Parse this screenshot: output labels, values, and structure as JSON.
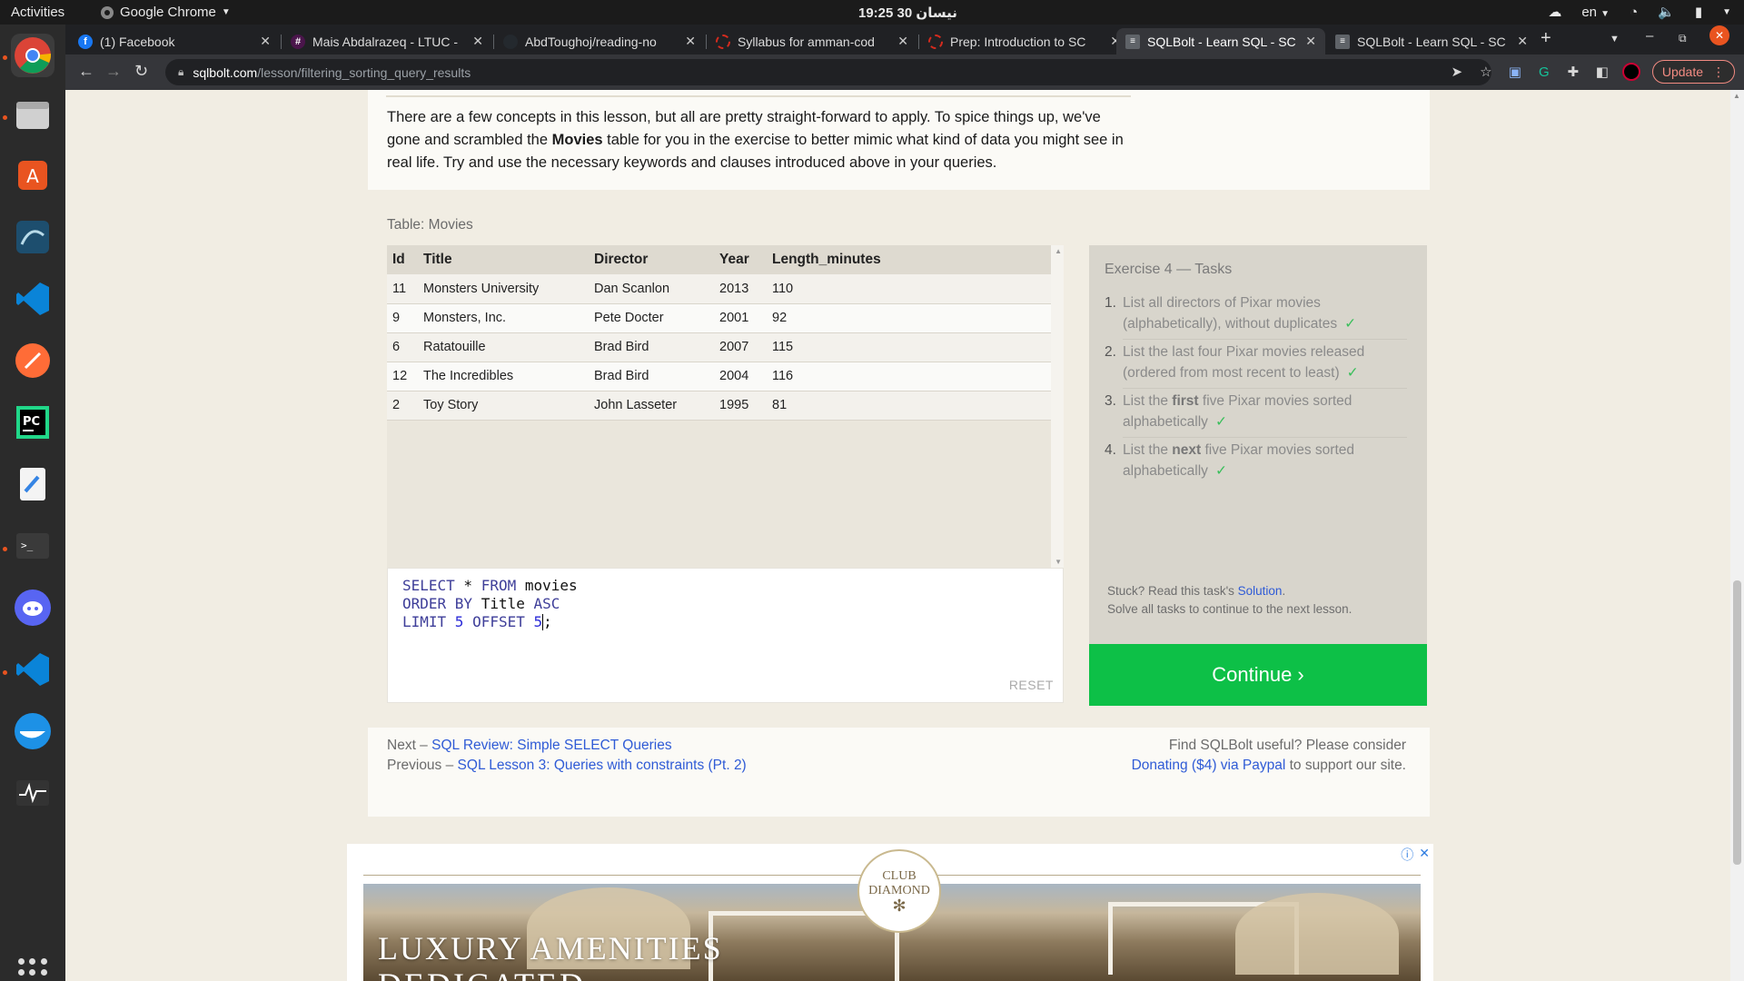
{
  "topbar": {
    "activities": "Activities",
    "app_name": "Google Chrome",
    "clock": "19:25  30 نيسان",
    "lang": "en"
  },
  "tabs": [
    {
      "title": "(1) Facebook",
      "favicon_color": "#1877f2",
      "favicon_glyph": "f"
    },
    {
      "title": "Mais Abdalrazeq - LTUC -",
      "favicon_color": "#4a154b",
      "favicon_glyph": "#"
    },
    {
      "title": "AbdToughoj/reading-no",
      "favicon_color": "#24292e",
      "favicon_glyph": "●"
    },
    {
      "title": "Syllabus for amman-cod",
      "favicon_color": "#d52b1e",
      "favicon_glyph": "○"
    },
    {
      "title": "Prep: Introduction to SC",
      "favicon_color": "#d52b1e",
      "favicon_glyph": "○"
    },
    {
      "title": "SQLBolt - Learn SQL - SC",
      "favicon_color": "#9aa0a6",
      "favicon_glyph": "≡"
    },
    {
      "title": "SQLBolt - Learn SQL - SC",
      "favicon_color": "#9aa0a6",
      "favicon_glyph": "≡"
    }
  ],
  "address": {
    "host": "sqlbolt.com",
    "path": "/lesson/filtering_sorting_query_results"
  },
  "update_label": "Update",
  "intro": {
    "part1": "There are a few concepts in this lesson, but all are pretty straight-forward to apply. To spice things up, we've gone and scrambled the ",
    "bold": "Movies",
    "part2": " table for you in the exercise to better mimic what kind of data you might see in real life. Try and use the necessary keywords and clauses introduced above in your queries."
  },
  "table": {
    "caption": "Table: Movies",
    "columns": [
      "Id",
      "Title",
      "Director",
      "Year",
      "Length_minutes"
    ],
    "rows": [
      [
        "11",
        "Monsters University",
        "Dan Scanlon",
        "2013",
        "110"
      ],
      [
        "9",
        "Monsters, Inc.",
        "Pete Docter",
        "2001",
        "92"
      ],
      [
        "6",
        "Ratatouille",
        "Brad Bird",
        "2007",
        "115"
      ],
      [
        "12",
        "The Incredibles",
        "Brad Bird",
        "2004",
        "116"
      ],
      [
        "2",
        "Toy Story",
        "John Lasseter",
        "1995",
        "81"
      ]
    ]
  },
  "editor": {
    "line1": {
      "kw1": "SELECT",
      "mid": " * ",
      "kw2": "FROM",
      "rest": " movies"
    },
    "line2": {
      "kw1": "ORDER BY",
      "mid": " Title ",
      "kw2": "ASC"
    },
    "line3": {
      "kw1": "LIMIT",
      "num1": " 5 ",
      "kw2": "OFFSET",
      "num2": " 5",
      "tail": ";"
    },
    "reset_label": "RESET"
  },
  "tasks": {
    "heading": "Exercise 4 — Tasks",
    "items": [
      {
        "n": "1.",
        "pre": "List all directors of Pixar movies (alphabetically), without duplicates",
        "bold": "",
        "post": "",
        "done": "✓"
      },
      {
        "n": "2.",
        "pre": "List the last four Pixar movies released (ordered from most recent to least)",
        "bold": "",
        "post": "",
        "done": "✓"
      },
      {
        "n": "3.",
        "pre": "List the ",
        "bold": "first",
        "post": " five Pixar movies sorted alphabetically",
        "done": "✓"
      },
      {
        "n": "4.",
        "pre": "List the ",
        "bold": "next",
        "post": " five Pixar movies sorted alphabetically",
        "done": "✓"
      }
    ],
    "stuck_pre": "Stuck? Read this task's ",
    "stuck_link": "Solution",
    "stuck_post": ".",
    "solve_all": "Solve all tasks to continue to the next lesson."
  },
  "continue_label": "Continue ›",
  "footer": {
    "next_prefix": "Next – ",
    "next_link": "SQL Review: Simple SELECT Queries",
    "prev_prefix": "Previous – ",
    "prev_link": "SQL Lesson 3: Queries with constraints (Pt. 2)",
    "donate_line1": "Find SQLBolt useful? Please consider",
    "donate_link": "Donating ($4) via Paypal",
    "donate_post": " to support our site."
  },
  "ad": {
    "logo_top": "CLUB",
    "logo_bottom": "DIAMOND",
    "headline": "LUXURY AMENITIES",
    "headline2": "DEDICATED"
  },
  "colors": {
    "continue_green": "#0dc047",
    "link_blue": "#2f5bd6",
    "check_green": "#3bbf5c"
  }
}
